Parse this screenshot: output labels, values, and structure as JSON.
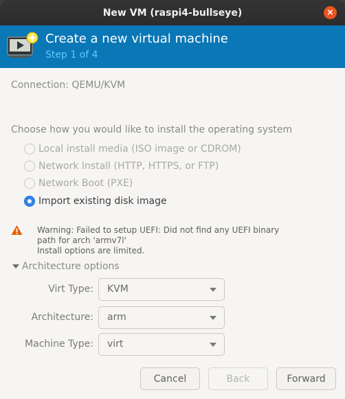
{
  "window": {
    "title": "New VM (raspi4-bullseye)",
    "close_glyph": "×"
  },
  "header": {
    "title": "Create a new virtual machine",
    "step": "Step 1 of 4",
    "icon": "vm-monitor-icon"
  },
  "connection": {
    "text": "Connection: QEMU/KVM"
  },
  "install": {
    "heading": "Choose how you would like to install the operating system",
    "options": [
      {
        "label": "Local install media (ISO image or CDROM)",
        "checked": false,
        "enabled": false
      },
      {
        "label": "Network Install (HTTP, HTTPS, or FTP)",
        "checked": false,
        "enabled": false
      },
      {
        "label": "Network Boot (PXE)",
        "checked": false,
        "enabled": false
      },
      {
        "label": "Import existing disk image",
        "checked": true,
        "enabled": true
      }
    ]
  },
  "warning": {
    "line1": "Warning: Failed to setup UEFI: Did not find any UEFI binary",
    "line2": "path for arch 'armv7l'",
    "line3": "Install options are limited."
  },
  "architecture": {
    "toggle_label": "Architecture options",
    "fields": [
      {
        "label": "Virt Type:",
        "value": "KVM"
      },
      {
        "label": "Architecture:",
        "value": "arm"
      },
      {
        "label": "Machine Type:",
        "value": "virt"
      }
    ]
  },
  "buttons": {
    "cancel": "Cancel",
    "back": "Back",
    "forward": "Forward"
  },
  "colors": {
    "header_bg": "#0a77b6",
    "step_text": "#63c9ff",
    "radio_accent": "#3584e4",
    "close_button": "#e95420",
    "warning": "#e66100"
  }
}
